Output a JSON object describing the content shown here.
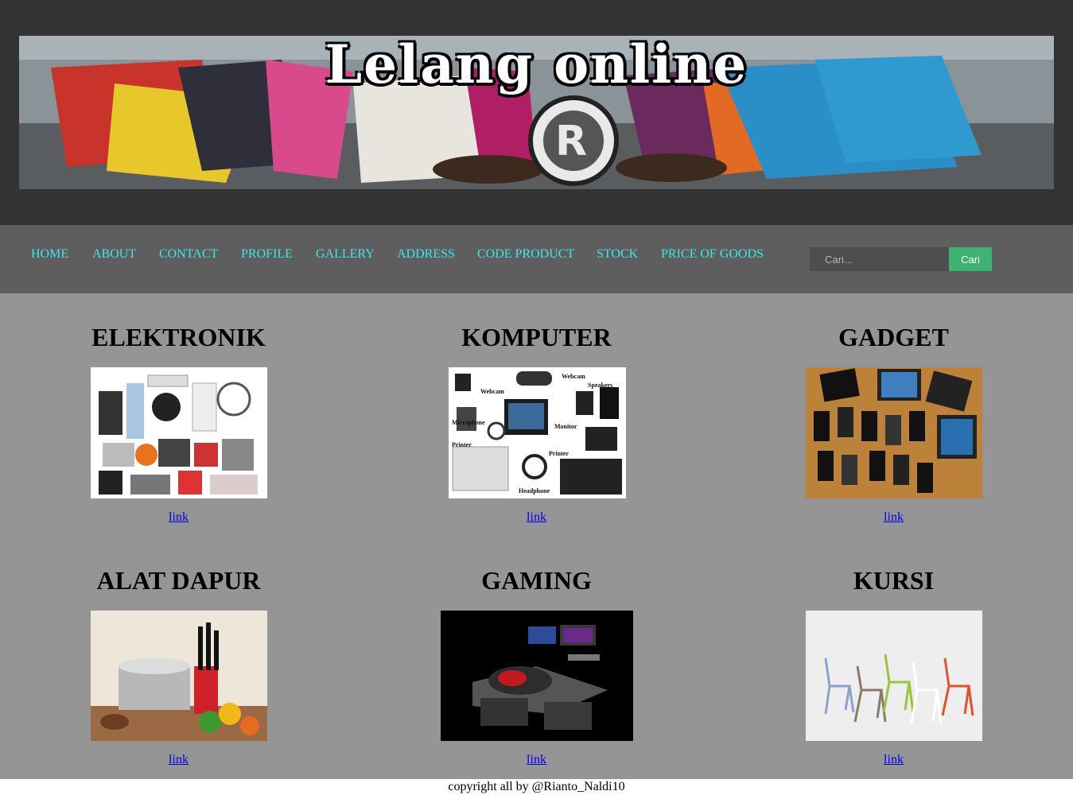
{
  "banner": {
    "title": "Lelang online",
    "mark": "R"
  },
  "nav": {
    "items": [
      "HOME",
      "ABOUT",
      "CONTACT",
      "PROFILE",
      "GALLERY",
      "ADDRESS",
      "CODE PRODUCT",
      "STOCK",
      "PRICE OF GOODS"
    ],
    "color": "#3be8e8"
  },
  "search": {
    "placeholder": "Cari...",
    "button_label": "Cari"
  },
  "komputer_labels": [
    "Webcam",
    "Speakers",
    "Webcam",
    "Microphone",
    "Monitor",
    "Printer",
    "Printer",
    "Headphone"
  ],
  "categories": [
    {
      "title": "ELEKTRONIK",
      "link": "link"
    },
    {
      "title": "KOMPUTER",
      "link": "link"
    },
    {
      "title": "GADGET",
      "link": "link"
    },
    {
      "title": "ALAT DAPUR",
      "link": "link"
    },
    {
      "title": "GAMING",
      "link": "link"
    },
    {
      "title": "KURSI",
      "link": "link"
    }
  ],
  "footer": {
    "text": "copyright all by @Rianto_Naldi10"
  },
  "colors": {
    "header_bg": "#333333",
    "nav_bg": "#5e5e5e",
    "main_bg": "#959595",
    "search_button": "#3eb371",
    "link": "#0000ee"
  }
}
